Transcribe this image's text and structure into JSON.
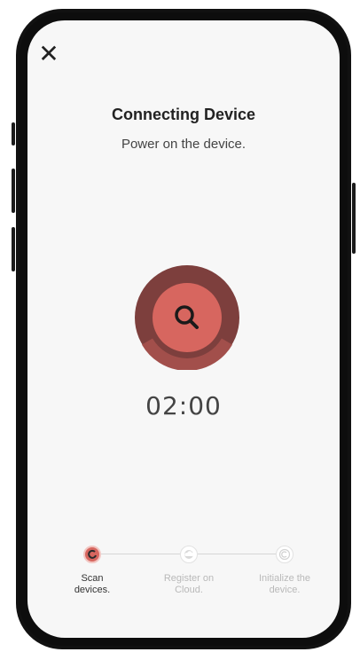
{
  "header": {
    "close_icon": "close-icon",
    "title": "Connecting Device",
    "subtitle": "Power on the device."
  },
  "scan": {
    "icon": "search-icon",
    "timer": "02:00",
    "colors": {
      "outer": "#7d3f3d",
      "inner": "#d7665f",
      "arc": "#a24f4b"
    }
  },
  "steps": [
    {
      "label_line1": "Scan",
      "label_line2": "devices.",
      "state": "active",
      "icon": "spinner-icon"
    },
    {
      "label_line1": "Register on",
      "label_line2": "Cloud.",
      "state": "pending",
      "icon": "cloud-icon"
    },
    {
      "label_line1": "Initialize the",
      "label_line2": "device.",
      "state": "pending",
      "icon": "power-icon"
    }
  ]
}
